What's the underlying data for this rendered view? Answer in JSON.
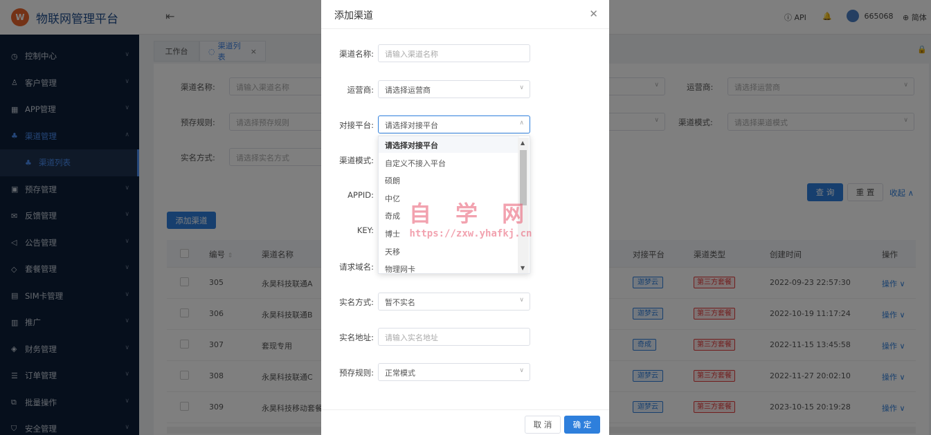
{
  "brand": {
    "title": "物联网管理平台",
    "logo_text": "W"
  },
  "topbar": {
    "api": "API",
    "user": "665068",
    "lang": "简体"
  },
  "menu": [
    {
      "label": "控制中心",
      "icon": "◷"
    },
    {
      "label": "客户管理",
      "icon": "♙"
    },
    {
      "label": "APP管理",
      "icon": "▦"
    },
    {
      "label": "渠道管理",
      "icon": "♣"
    },
    {
      "label": "渠道列表",
      "icon": "♣"
    },
    {
      "label": "预存管理",
      "icon": "▣"
    },
    {
      "label": "反馈管理",
      "icon": "✉"
    },
    {
      "label": "公告管理",
      "icon": "◁"
    },
    {
      "label": "套餐管理",
      "icon": "◇"
    },
    {
      "label": "SIM卡管理",
      "icon": "▤"
    },
    {
      "label": "推广",
      "icon": "▥"
    },
    {
      "label": "财务管理",
      "icon": "◈"
    },
    {
      "label": "订单管理",
      "icon": "☰"
    },
    {
      "label": "批量操作",
      "icon": "⧉"
    },
    {
      "label": "安全管理",
      "icon": "⛉"
    }
  ],
  "tabs": {
    "workbench": "工作台",
    "channel_list": "渠道列表"
  },
  "filters": {
    "channel_name_label": "渠道名称:",
    "channel_name_ph": "请输入渠道名称",
    "carrier_label": "运营商:",
    "carrier_ph": "请选择运营商",
    "prestore_label": "预存规则:",
    "prestore_ph": "请选择预存规则",
    "mode_label": "渠道模式:",
    "mode_ph": "请选择渠道模式",
    "realname_label": "实名方式:",
    "realname_ph": "请选择实名方式",
    "query": "查 询",
    "reset": "重 置",
    "collapse": "收起"
  },
  "add_button": "添加渠道",
  "table": {
    "headers": {
      "id": "编号",
      "name": "渠道名称",
      "platform": "对接平台",
      "type": "渠道类型",
      "created": "创建时间",
      "op": "操作"
    },
    "rows": [
      {
        "id": "305",
        "name": "永昊科技联通A",
        "platform": "迦梦云",
        "type": "第三方套餐",
        "created": "2022-09-23 22:57:30",
        "op": "操作"
      },
      {
        "id": "306",
        "name": "永昊科技联通B",
        "platform": "迦梦云",
        "type": "第三方套餐",
        "created": "2022-10-19 11:17:24",
        "op": "操作"
      },
      {
        "id": "307",
        "name": "套现专用",
        "platform": "奇成",
        "type": "第三方套餐",
        "created": "2022-11-15 13:45:58",
        "op": "操作"
      },
      {
        "id": "308",
        "name": "永昊科技联通C",
        "platform": "迦梦云",
        "type": "第三方套餐",
        "created": "2022-11-27 20:02:10",
        "op": "操作"
      },
      {
        "id": "309",
        "name": "永昊科技移动套餐",
        "platform": "迦梦云",
        "type": "第三方套餐",
        "created": "2023-10-15 20:19:28",
        "op": "操作"
      }
    ]
  },
  "modal": {
    "title": "添加渠道",
    "fields": {
      "name_label": "渠道名称:",
      "name_ph": "请输入渠道名称",
      "carrier_label": "运营商:",
      "carrier_ph": "请选择运营商",
      "platform_label": "对接平台:",
      "platform_ph": "请选择对接平台",
      "mode_label": "渠道模式:",
      "appid_label": "APPID:",
      "key_label": "KEY:",
      "domain_label": "请求域名:",
      "realname_label": "实名方式:",
      "realname_value": "暂不实名",
      "realname_url_label": "实名地址:",
      "realname_url_ph": "请输入实名地址",
      "prestore_label": "预存规则:",
      "prestore_value": "正常模式"
    },
    "dropdown_options": [
      "请选择对接平台",
      "自定义不接入平台",
      "硕朗",
      "中亿",
      "奇成",
      "博士",
      "天移",
      "物理网卡"
    ],
    "cancel": "取 消",
    "confirm": "确 定"
  },
  "watermark": {
    "line1": "自 学 网",
    "line2": "https://zxw.yhafkj.cn"
  }
}
